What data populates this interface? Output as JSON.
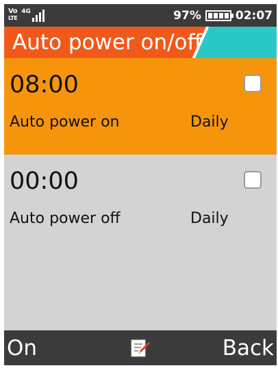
{
  "status_bar": {
    "volte_top": "Vo",
    "volte_bottom": "LTE",
    "network": "4G",
    "battery_percent": "97%",
    "time": "02:07",
    "battery_level": 0.97
  },
  "header": {
    "title": "Auto power on/off"
  },
  "items": [
    {
      "time": "08:00",
      "label": "Auto power on",
      "repeat": "Daily",
      "checked": false,
      "selected": true
    },
    {
      "time": "00:00",
      "label": "Auto power off",
      "repeat": "Daily",
      "checked": false,
      "selected": false
    }
  ],
  "softkeys": {
    "left": "On",
    "center_icon": "edit-icon",
    "right": "Back"
  },
  "colors": {
    "header_orange": "#f1591a",
    "header_teal": "#2bc9c6",
    "selected_item": "#f6950c",
    "list_background": "#d3d3d3",
    "bars_background": "#3b3b3b"
  }
}
